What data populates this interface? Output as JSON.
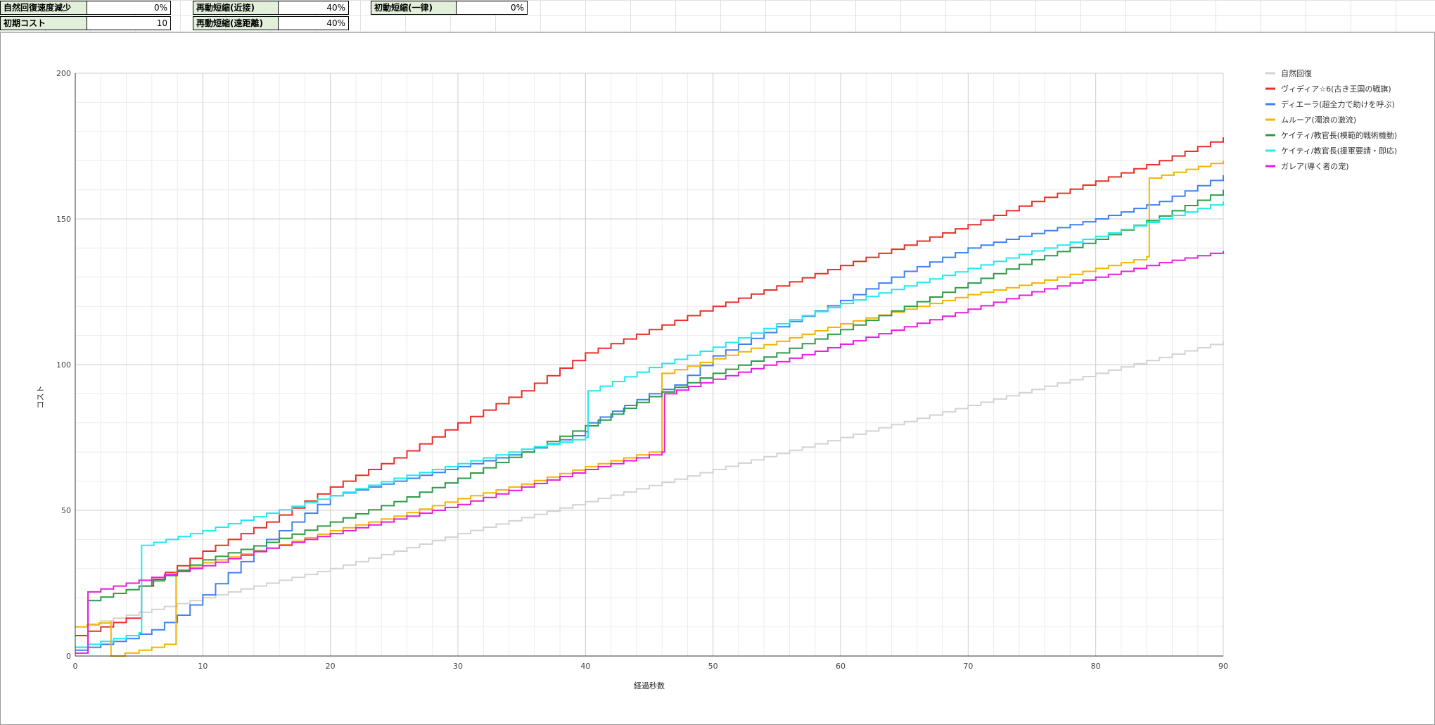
{
  "settings": [
    {
      "label": "自然回復速度減少",
      "value": "0%"
    },
    {
      "label": "初期コスト",
      "value": "10"
    },
    {
      "label": "再動短縮(近接)",
      "value": "40%"
    },
    {
      "label": "再動短縮(遠距離)",
      "value": "40%"
    },
    {
      "label": "初動短縮(一律)",
      "value": "0%"
    }
  ],
  "chart_data": {
    "type": "line",
    "step": true,
    "title": "",
    "xlabel": "経過秒数",
    "ylabel": "コスト",
    "xlim": [
      0,
      90
    ],
    "ylim": [
      0,
      200
    ],
    "xticks": [
      0,
      10,
      20,
      30,
      40,
      50,
      60,
      70,
      80,
      90
    ],
    "yticks": [
      0,
      50,
      100,
      150,
      200
    ],
    "grid": true,
    "legend": "right",
    "series": [
      {
        "name": "自然回復",
        "color": "#d3d3d3",
        "points": [
          [
            0,
            10
          ],
          [
            10,
            20
          ],
          [
            20,
            30
          ],
          [
            30,
            42
          ],
          [
            40,
            53
          ],
          [
            50,
            64
          ],
          [
            60,
            75
          ],
          [
            70,
            86
          ],
          [
            80,
            97
          ],
          [
            90,
            108
          ]
        ]
      },
      {
        "name": "ヴィディア☆6(古き王国の戦旗)",
        "color": "#e8302a",
        "points": [
          [
            0,
            7
          ],
          [
            2,
            10
          ],
          [
            4,
            13
          ],
          [
            5,
            13
          ],
          [
            5.2,
            24
          ],
          [
            8,
            31
          ],
          [
            10,
            36
          ],
          [
            15,
            46
          ],
          [
            20,
            58
          ],
          [
            25,
            68
          ],
          [
            30,
            80
          ],
          [
            35,
            91
          ],
          [
            40,
            104
          ],
          [
            45,
            112
          ],
          [
            50,
            120
          ],
          [
            55,
            127
          ],
          [
            60,
            134
          ],
          [
            65,
            141
          ],
          [
            70,
            148
          ],
          [
            75,
            156
          ],
          [
            80,
            163
          ],
          [
            85,
            170
          ],
          [
            90,
            178
          ]
        ]
      },
      {
        "name": "ディエーラ(超全力で助けを呼ぶ)",
        "color": "#3f82f0",
        "points": [
          [
            0,
            2
          ],
          [
            2,
            4
          ],
          [
            4,
            6
          ],
          [
            6,
            9
          ],
          [
            8,
            14
          ],
          [
            10,
            21
          ],
          [
            15,
            40
          ],
          [
            20,
            55
          ],
          [
            25,
            60
          ],
          [
            30,
            65
          ],
          [
            35,
            70
          ],
          [
            40,
            77
          ],
          [
            40.2,
            80
          ],
          [
            45,
            90
          ],
          [
            47,
            93
          ],
          [
            50,
            103
          ],
          [
            55,
            113
          ],
          [
            60,
            122
          ],
          [
            65,
            132
          ],
          [
            70,
            140
          ],
          [
            75,
            145
          ],
          [
            80,
            150
          ],
          [
            85,
            156
          ],
          [
            90,
            165
          ]
        ]
      },
      {
        "name": "ムルーア(濁浪の激流)",
        "color": "#f4b400",
        "points": [
          [
            0,
            10
          ],
          [
            2.8,
            12
          ],
          [
            2.8,
            0
          ],
          [
            5,
            2
          ],
          [
            7,
            4
          ],
          [
            7.9,
            5
          ],
          [
            7.9,
            29
          ],
          [
            10,
            32
          ],
          [
            15,
            37
          ],
          [
            20,
            43
          ],
          [
            25,
            48
          ],
          [
            30,
            54
          ],
          [
            35,
            59
          ],
          [
            40,
            65
          ],
          [
            45,
            70
          ],
          [
            46,
            72
          ],
          [
            46,
            97
          ],
          [
            50,
            102
          ],
          [
            55,
            108
          ],
          [
            60,
            114
          ],
          [
            65,
            119
          ],
          [
            70,
            124
          ],
          [
            75,
            128
          ],
          [
            80,
            133
          ],
          [
            84,
            137
          ],
          [
            84.2,
            164
          ],
          [
            90,
            170
          ]
        ]
      },
      {
        "name": "ケイティ/教官長(模範的戦術機動)",
        "color": "#2e9c4a",
        "points": [
          [
            0,
            3
          ],
          [
            1,
            3
          ],
          [
            1,
            19
          ],
          [
            5,
            24
          ],
          [
            10,
            33
          ],
          [
            15,
            39
          ],
          [
            20,
            46
          ],
          [
            25,
            53
          ],
          [
            30,
            61
          ],
          [
            35,
            70
          ],
          [
            40,
            79
          ],
          [
            45,
            89
          ],
          [
            50,
            97
          ],
          [
            55,
            104
          ],
          [
            60,
            112
          ],
          [
            65,
            120
          ],
          [
            70,
            128
          ],
          [
            75,
            136
          ],
          [
            80,
            143
          ],
          [
            85,
            151
          ],
          [
            90,
            160
          ]
        ]
      },
      {
        "name": "ケイティ/教官長(援軍要請・即応)",
        "color": "#22e8f0",
        "points": [
          [
            0,
            3
          ],
          [
            5,
            8
          ],
          [
            5.2,
            38
          ],
          [
            10,
            43
          ],
          [
            15,
            49
          ],
          [
            20,
            55
          ],
          [
            25,
            61
          ],
          [
            30,
            66
          ],
          [
            35,
            71
          ],
          [
            40,
            75
          ],
          [
            40.2,
            91
          ],
          [
            45,
            99
          ],
          [
            50,
            106
          ],
          [
            55,
            114
          ],
          [
            60,
            121
          ],
          [
            65,
            127
          ],
          [
            70,
            133
          ],
          [
            75,
            139
          ],
          [
            80,
            144
          ],
          [
            85,
            150
          ],
          [
            90,
            156
          ]
        ]
      },
      {
        "name": "ガレア(導く者の宠)",
        "color": "#e81ee0",
        "points": [
          [
            0,
            1
          ],
          [
            1,
            1
          ],
          [
            1,
            22
          ],
          [
            5,
            26
          ],
          [
            10,
            31
          ],
          [
            15,
            37
          ],
          [
            20,
            42
          ],
          [
            25,
            47
          ],
          [
            30,
            52
          ],
          [
            35,
            58
          ],
          [
            40,
            64
          ],
          [
            46,
            70
          ],
          [
            46.2,
            90
          ],
          [
            50,
            95
          ],
          [
            55,
            101
          ],
          [
            60,
            107
          ],
          [
            65,
            113
          ],
          [
            70,
            119
          ],
          [
            75,
            125
          ],
          [
            80,
            130
          ],
          [
            85,
            135
          ],
          [
            90,
            139
          ]
        ]
      }
    ]
  }
}
